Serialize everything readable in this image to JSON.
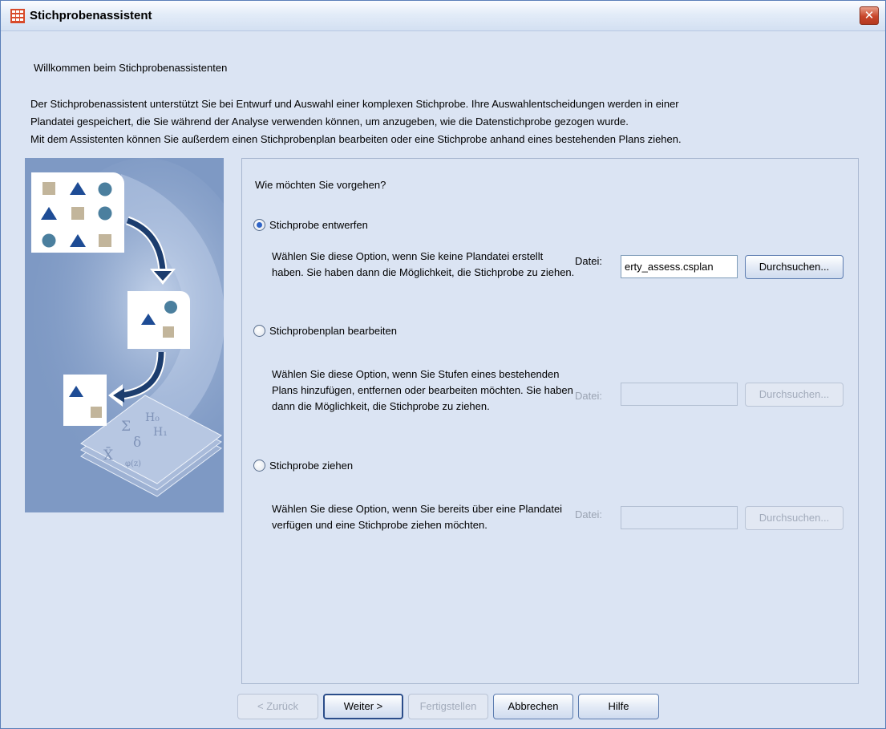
{
  "window": {
    "title": "Stichprobenassistent",
    "close_label": "✕"
  },
  "intro": {
    "welcome": "Willkommen beim Stichprobenassistenten",
    "lines": [
      "Der Stichprobenassistent unterstützt Sie bei Entwurf und Auswahl einer komplexen Stichprobe. Ihre Auswahlentscheidungen werden in einer",
      "Plandatei gespeichert, die Sie während der Analyse verwenden können, um anzugeben, wie die Datenstichprobe gezogen wurde.",
      "Mit dem Assistenten können Sie außerdem einen Stichprobenplan bearbeiten oder eine Stichprobe anhand eines bestehenden Plans ziehen."
    ]
  },
  "panel": {
    "question": "Wie möchten Sie vorgehen?",
    "options": [
      {
        "label": "Stichprobe entwerfen",
        "checked": true,
        "desc": "Wählen Sie diese Option, wenn Sie keine Plandatei erstellt haben. Sie haben dann die Möglichkeit, die Stichprobe zu ziehen.",
        "file_label": "Datei:",
        "file_value": "erty_assess.csplan",
        "browse_label": "Durchsuchen..."
      },
      {
        "label": "Stichprobenplan bearbeiten",
        "checked": false,
        "desc": "Wählen Sie diese Option, wenn Sie Stufen eines bestehenden Plans hinzufügen, entfernen oder bearbeiten möchten. Sie haben dann die Möglichkeit, die Stichprobe zu ziehen.",
        "file_label": "Datei:",
        "file_value": "",
        "browse_label": "Durchsuchen..."
      },
      {
        "label": "Stichprobe ziehen",
        "checked": false,
        "desc": "Wählen Sie diese Option, wenn Sie bereits über eine Plandatei verfügen und eine Stichprobe ziehen möchten.",
        "file_label": "Datei:",
        "file_value": "",
        "browse_label": "Durchsuchen..."
      }
    ]
  },
  "buttons": {
    "back": "< Zurück",
    "next": "Weiter >",
    "finish": "Fertigstellen",
    "cancel": "Abbrechen",
    "help": "Hilfe"
  },
  "illustration": {
    "formula_symbols": [
      "Σ",
      "H₀",
      "δ",
      "H₁",
      "X̄",
      "φ(z)"
    ]
  },
  "colors": {
    "accent": "#2f64c7",
    "dark_shape": "#1e4c95",
    "teal_shape": "#4b7f9e",
    "tan_shape": "#c2b59b",
    "illustration_bg": "#7e99c4"
  }
}
